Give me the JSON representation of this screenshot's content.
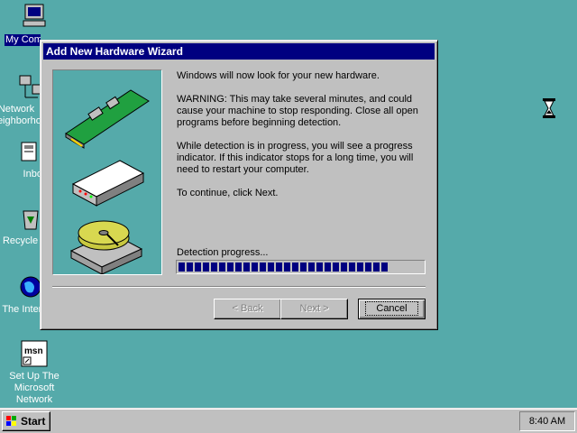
{
  "desktop": {
    "icons": [
      {
        "label": "My Computer"
      },
      {
        "label": "Network Neighborhood"
      },
      {
        "label": "Inbox"
      },
      {
        "label": "Recycle Bin"
      },
      {
        "label": "The Internet"
      },
      {
        "label": "Set Up The Microsoft Network"
      }
    ]
  },
  "wizard": {
    "title": "Add New Hardware Wizard",
    "paragraphs": [
      "Windows will now look for your new hardware.",
      "WARNING: This may take several minutes, and could cause your machine to stop responding. Close all open programs before beginning detection.",
      "While detection is in progress, you will see a progress indicator. If this indicator stops for a long time, you will need to restart your computer.",
      "To continue, click Next."
    ],
    "progress_label": "Detection progress...",
    "progress_value": 0.88,
    "buttons": {
      "back": "< Back",
      "next": "Next >",
      "cancel": "Cancel"
    }
  },
  "taskbar": {
    "start_label": "Start",
    "clock": "8:40 AM"
  },
  "colors": {
    "desktop": "#55aaaa",
    "titlebar": "#000080",
    "progress": "#000080"
  },
  "icons": [
    "my-computer-icon",
    "network-icon",
    "inbox-icon",
    "recycle-bin-icon",
    "internet-icon",
    "msn-icon",
    "hourglass-icon",
    "windows-flag-icon"
  ]
}
